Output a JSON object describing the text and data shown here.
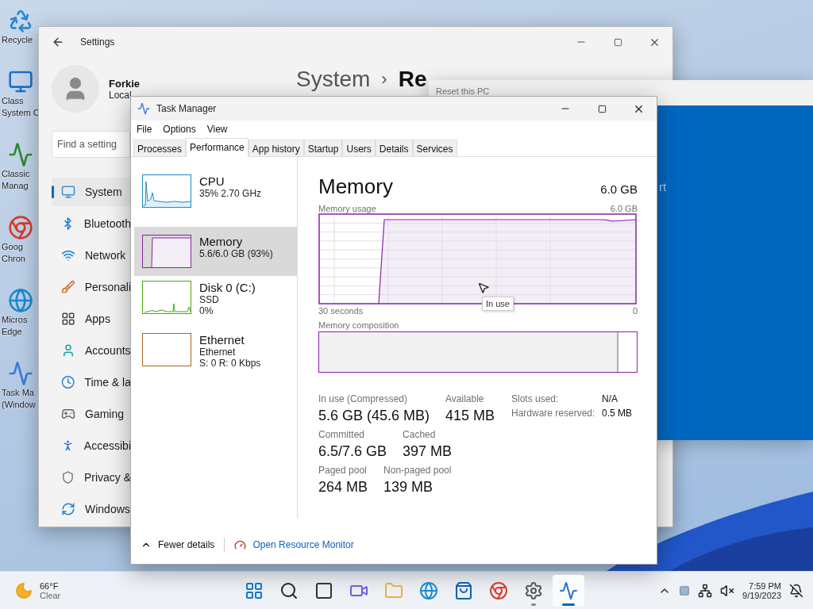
{
  "desktop_icons": [
    {
      "lines": [
        "Recycle"
      ]
    },
    {
      "lines": [
        "Class",
        "System C"
      ]
    },
    {
      "lines": [
        "Classic",
        "Manag"
      ]
    },
    {
      "lines": [
        "Goog",
        "Chron"
      ]
    },
    {
      "lines": [
        "Micros",
        "Edge"
      ]
    },
    {
      "lines": [
        "Task Ma",
        "(Window"
      ]
    }
  ],
  "settings": {
    "title": "Settings",
    "user": {
      "name": "Forkie",
      "account": "Local"
    },
    "search": {
      "placeholder": "Find a setting"
    },
    "breadcrumb": {
      "parent": "System",
      "separator": "›",
      "current": "Re"
    },
    "nav": [
      {
        "label": "System",
        "selected": true
      },
      {
        "label": "Bluetooth",
        "selected": false
      },
      {
        "label": "Network",
        "selected": false
      },
      {
        "label": "Personali",
        "selected": false
      },
      {
        "label": "Apps",
        "selected": false
      },
      {
        "label": "Accounts",
        "selected": false
      },
      {
        "label": "Time & la",
        "selected": false
      },
      {
        "label": "Gaming",
        "selected": false
      },
      {
        "label": "Accessibi",
        "selected": false
      },
      {
        "label": "Privacy &",
        "selected": false
      },
      {
        "label": "Windows",
        "selected": false
      }
    ]
  },
  "reset_dialog": {
    "title": "Reset this PC",
    "text": "rt"
  },
  "task_manager": {
    "title": "Task Manager",
    "menu": [
      "File",
      "Options",
      "View"
    ],
    "tabs": [
      {
        "label": "Processes",
        "selected": false
      },
      {
        "label": "Performance",
        "selected": true
      },
      {
        "label": "App history",
        "selected": false
      },
      {
        "label": "Startup",
        "selected": false
      },
      {
        "label": "Users",
        "selected": false
      },
      {
        "label": "Details",
        "selected": false
      },
      {
        "label": "Services",
        "selected": false
      }
    ],
    "resources": [
      {
        "kind": "cpu",
        "name": "CPU",
        "lines": [
          "35%  2.70 GHz"
        ],
        "color": "#1a8ec9",
        "selected": false
      },
      {
        "kind": "memory",
        "name": "Memory",
        "lines": [
          "5.6/6.0 GB (93%)"
        ],
        "color": "#8b22a8",
        "selected": true
      },
      {
        "kind": "disk",
        "name": "Disk 0 (C:)",
        "lines": [
          "SSD",
          "0%"
        ],
        "color": "#4da60c",
        "selected": false
      },
      {
        "kind": "network",
        "name": "Ethernet",
        "lines": [
          "Ethernet",
          "S: 0 R: 0 Kbps"
        ],
        "color": "#a7661b",
        "selected": false
      }
    ],
    "detail": {
      "title": "Memory",
      "total": "6.0 GB",
      "usage_label": "Memory usage",
      "usage_max": "6.0 GB",
      "x_start": "30 seconds",
      "x_end": "0",
      "tooltip": "In use",
      "composition_label": "Memory composition",
      "stats": [
        [
          {
            "label": "In use (Compressed)",
            "value": "5.6 GB (45.6 MB)"
          },
          {
            "label": "Available",
            "value": "415 MB"
          }
        ],
        [
          {
            "label": "Committed",
            "value": "6.5/7.6 GB"
          },
          {
            "label": "Cached",
            "value": "397 MB"
          }
        ],
        [
          {
            "label": "Paged pool",
            "value": "264 MB"
          },
          {
            "label": "Non-paged pool",
            "value": "139 MB"
          }
        ]
      ],
      "hardware": [
        {
          "label": "Slots used:",
          "value": "N/A"
        },
        {
          "label": "Hardware reserved:",
          "value": "0.5 MB"
        }
      ]
    },
    "footer": {
      "fewer": "Fewer details",
      "link": "Open Resource Monitor"
    }
  },
  "taskbar": {
    "weather": {
      "temp": "66°F",
      "condition": "Clear"
    },
    "apps": [
      {
        "running": false,
        "active": false
      },
      {
        "running": false,
        "active": false
      },
      {
        "running": false,
        "active": false
      },
      {
        "running": false,
        "active": false
      },
      {
        "running": false,
        "active": false
      },
      {
        "running": false,
        "active": false
      },
      {
        "running": false,
        "active": false
      },
      {
        "running": false,
        "active": false
      },
      {
        "running": true,
        "active": false
      },
      {
        "running": true,
        "active": true
      }
    ],
    "time": "7:59 PM",
    "date": "9/19/2023"
  }
}
